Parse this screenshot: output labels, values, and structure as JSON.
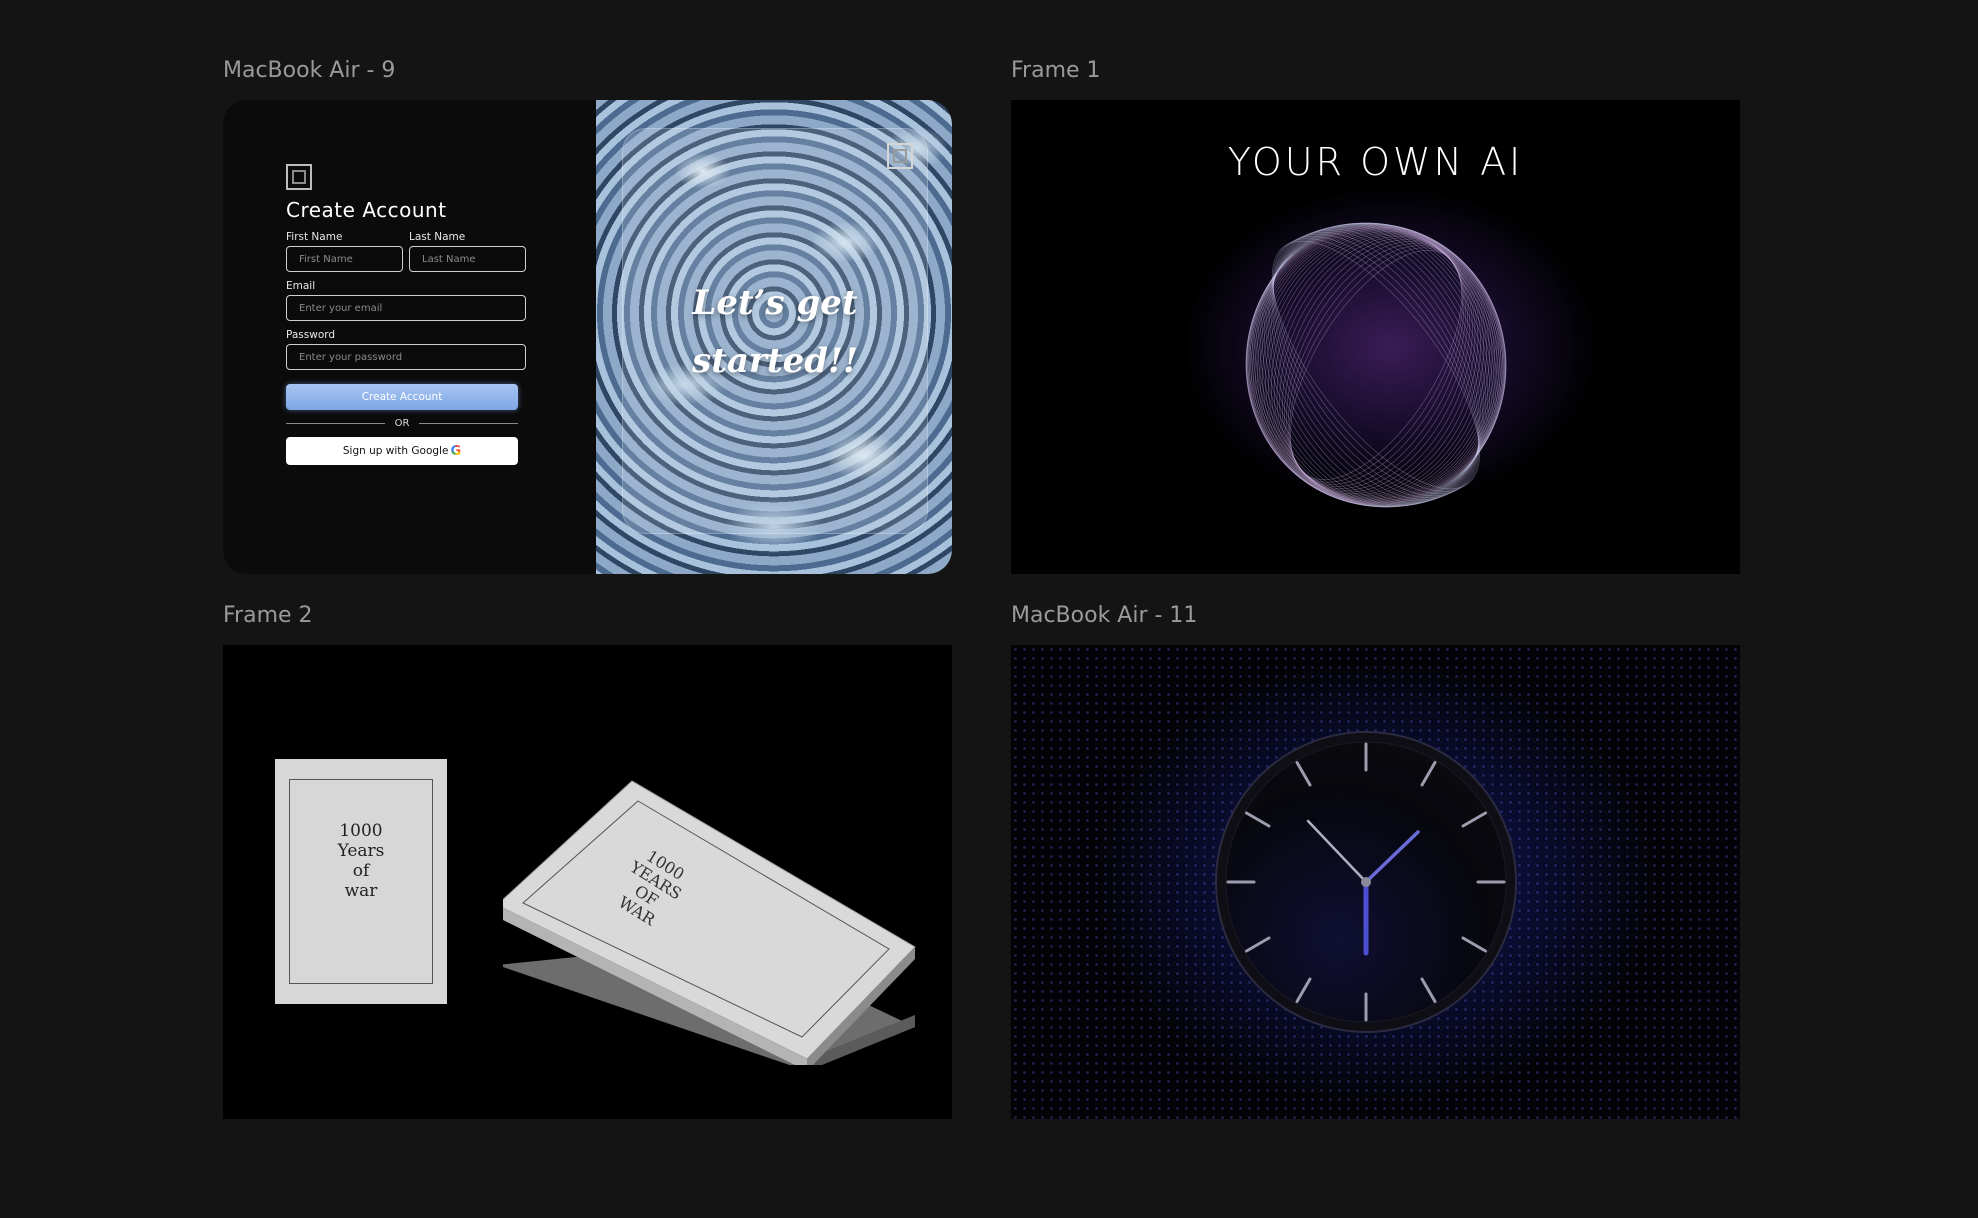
{
  "canvas": {
    "frames": [
      {
        "label": "MacBook Air - 9"
      },
      {
        "label": "Frame 1"
      },
      {
        "label": "Frame 2"
      },
      {
        "label": "MacBook Air - 11"
      }
    ]
  },
  "signup": {
    "title": "Create Account",
    "first_name_label": "First Name",
    "first_name_placeholder": "First Name",
    "last_name_label": "Last Name",
    "last_name_placeholder": "Last Name",
    "email_label": "Email",
    "email_placeholder": "Enter your email",
    "password_label": "Password",
    "password_placeholder": "Enter your password",
    "submit_label": "Create Account",
    "divider_label": "OR",
    "google_label": "Sign up with Google",
    "google_icon": "G",
    "tagline": "Let’s get\nstarted!!",
    "accent_color": "#8fb3ee"
  },
  "ai": {
    "headline": "YOUR OWN AI",
    "glow_color": "#3a1c55"
  },
  "book": {
    "cover_text": "1000\nYears\nof\nwar",
    "cover_lines": [
      "1000",
      "YEARS",
      "OF",
      "WAR"
    ]
  },
  "clock": {
    "accent_color": "#4b4fd1"
  }
}
